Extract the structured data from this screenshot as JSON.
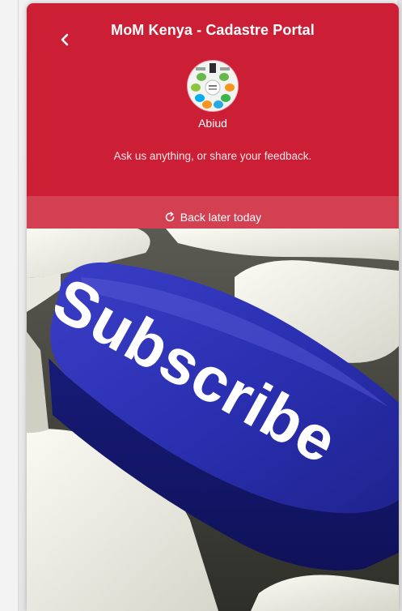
{
  "widget": {
    "title": "MoM Kenya - Cadastre Portal",
    "agent_name": "Abiud",
    "tagline": "Ask us anything, or share your feedback.",
    "status": "Back later today",
    "banner_text": "Subscribe",
    "icons": {
      "back": "chevron-left-icon",
      "status": "clock-refresh-icon"
    },
    "colors": {
      "header": "#cc1f35",
      "status_bar": "#d24052",
      "key": "#2a2fb0"
    }
  }
}
